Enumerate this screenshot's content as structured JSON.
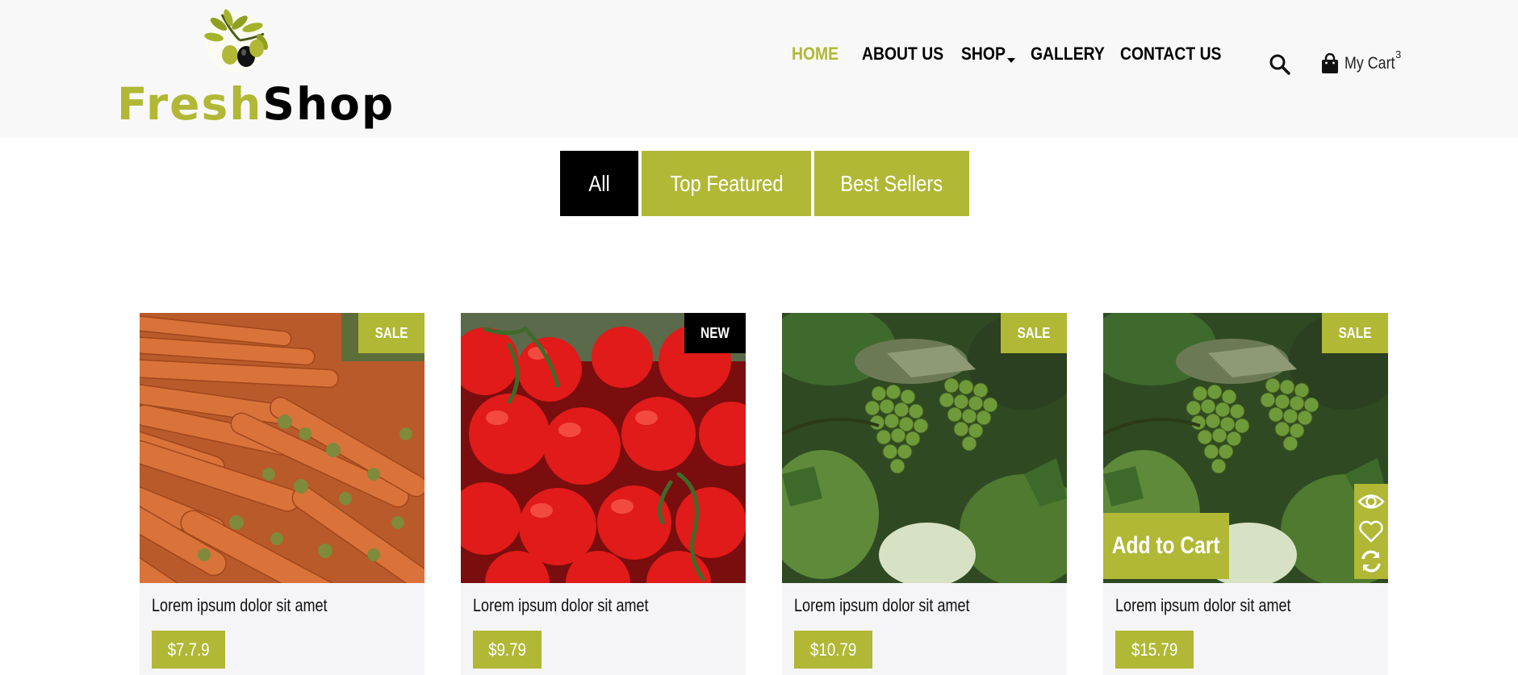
{
  "brand": {
    "name_part1": "Fresh",
    "name_part2": "Shop",
    "accent_color": "#b0b835"
  },
  "nav": {
    "items": [
      {
        "label": "HOME",
        "active": true
      },
      {
        "label": "ABOUT US",
        "active": false
      },
      {
        "label": "SHOP",
        "active": false,
        "has_dropdown": true
      },
      {
        "label": "GALLERY",
        "active": false
      },
      {
        "label": "CONTACT US",
        "active": false
      }
    ],
    "search_icon": "search-icon",
    "cart_label": "My Cart",
    "cart_count": "3"
  },
  "filters": [
    {
      "label": "All",
      "selected": true
    },
    {
      "label": "Top Featured",
      "selected": false
    },
    {
      "label": "Best Sellers",
      "selected": false
    }
  ],
  "products": [
    {
      "title": "Lorem ipsum dolor sit amet",
      "price": "$7.7.9",
      "badge": "SALE",
      "image": "carrots"
    },
    {
      "title": "Lorem ipsum dolor sit amet",
      "price": "$9.79",
      "badge": "NEW",
      "image": "tomatoes"
    },
    {
      "title": "Lorem ipsum dolor sit amet",
      "price": "$10.79",
      "badge": "SALE",
      "image": "grapes"
    },
    {
      "title": "Lorem ipsum dolor sit amet",
      "price": "$15.79",
      "badge": "SALE",
      "image": "grapes",
      "hover": true,
      "add_to_cart_label": "Add to Cart",
      "actions": [
        "eye-icon",
        "heart-icon",
        "refresh-icon"
      ]
    }
  ]
}
